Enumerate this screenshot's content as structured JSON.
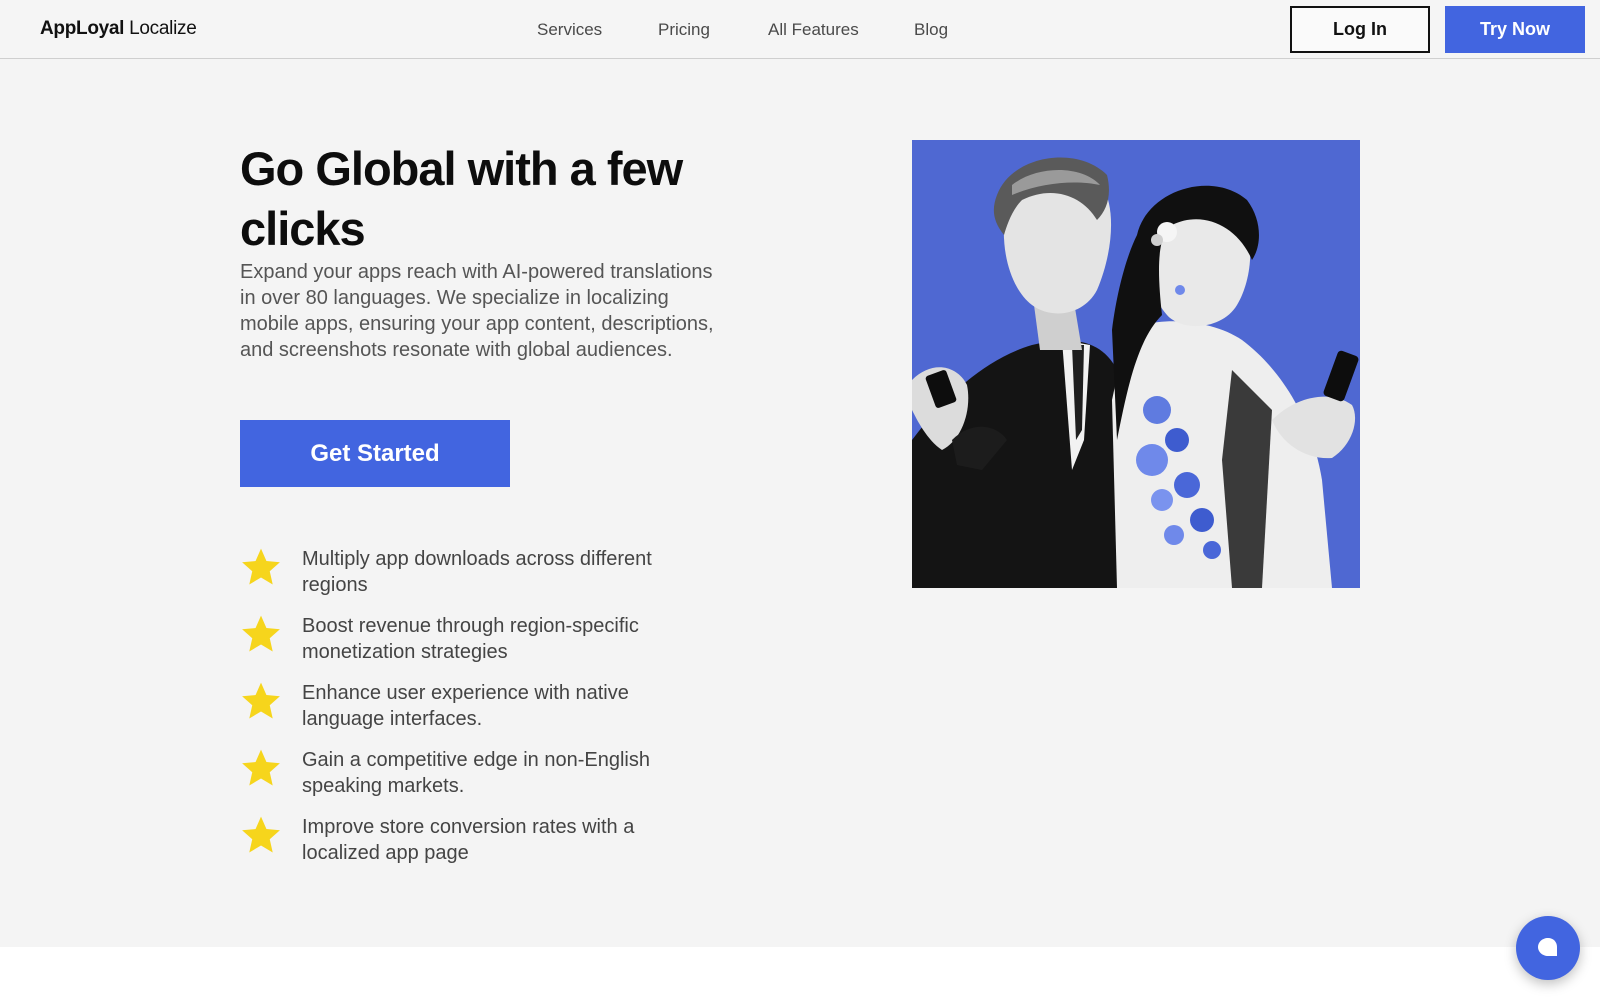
{
  "brand": {
    "bold": "AppLoyal",
    "regular": " Localize"
  },
  "nav": {
    "links": [
      "Services",
      "Pricing",
      "All Features",
      "Blog"
    ],
    "login_label": "Log In",
    "try_label": "Try Now"
  },
  "hero": {
    "headline": "Go Global with a few clicks",
    "subtitle": "Expand your apps reach with AI-powered translations in over 80 languages. We specialize in localizing mobile apps, ensuring your app content, descriptions, and screenshots resonate with global audiences.",
    "cta_label": "Get Started",
    "image_icon": "illustration-people-with-phones",
    "benefits": [
      "Multiply app downloads across different regions",
      "Boost revenue through region-specific monetization strategies",
      "Enhance user experience with native language interfaces.",
      "Gain a competitive edge in non-English speaking markets.",
      "Improve store conversion rates with a localized app page"
    ]
  },
  "colors": {
    "accent": "#4265e0",
    "star": "#f6d51c",
    "hero_bg": "#f4f4f4",
    "image_bg": "#4f68d2"
  },
  "chat": {
    "icon": "chat-bubble-icon"
  }
}
